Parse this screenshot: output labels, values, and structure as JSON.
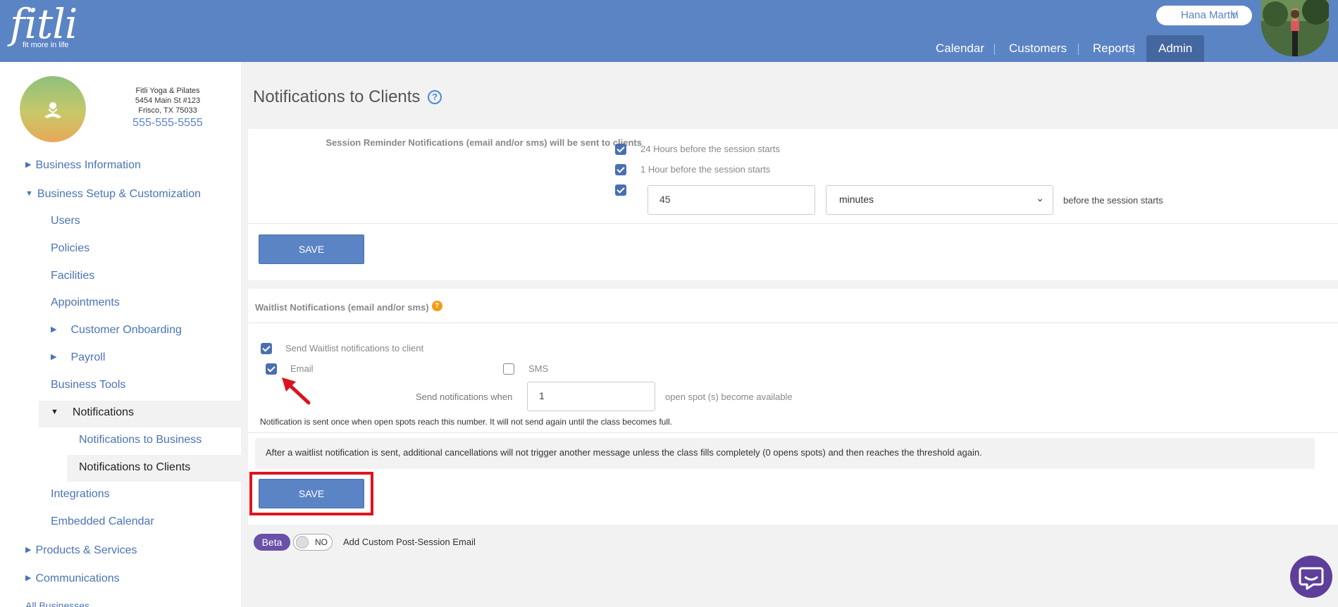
{
  "app": {
    "logo_text": "fitli",
    "logo_tagline": "fit more in life"
  },
  "header": {
    "user_name": "Hana Martin",
    "nav": [
      "Calendar",
      "Customers",
      "Reports",
      "Admin"
    ],
    "active_nav": "Admin"
  },
  "business": {
    "name": "Fitli Yoga & Pilates",
    "address1": "5454 Main St #123",
    "address2": "Frisco, TX 75033",
    "phone": "555-555-5555",
    "logo_text": "FITLI YOGA & PILATES"
  },
  "sidebar": {
    "items": [
      {
        "label": "Business Information",
        "caret": "▶"
      },
      {
        "label": "Business Setup & Customization",
        "caret": "▼"
      },
      {
        "label": "Users"
      },
      {
        "label": "Policies"
      },
      {
        "label": "Facilities"
      },
      {
        "label": "Appointments"
      },
      {
        "label": "Customer Onboarding",
        "caret": "▶"
      },
      {
        "label": "Payroll",
        "caret": "▶"
      },
      {
        "label": "Business Tools"
      },
      {
        "label": "Notifications",
        "caret": "▼"
      },
      {
        "label": "Notifications to Business"
      },
      {
        "label": "Notifications to Clients"
      },
      {
        "label": "Integrations"
      },
      {
        "label": "Embedded Calendar"
      },
      {
        "label": "Products & Services",
        "caret": "▶"
      },
      {
        "label": "Communications",
        "caret": "▶"
      },
      {
        "label": "All Businesses"
      }
    ]
  },
  "page": {
    "title": "Notifications to Clients",
    "help": "?"
  },
  "reminders": {
    "heading": "Session Reminder Notifications (email and/or sms) will be sent to clients",
    "option_24h": "24 Hours before the session starts",
    "option_1h": "1 Hour before the session starts",
    "custom_value": "45",
    "custom_unit": "minutes",
    "custom_suffix": "before the session starts",
    "save_label": "SAVE"
  },
  "waitlist": {
    "heading": "Waitlist Notifications (email and/or sms)",
    "help": "?",
    "send_label": "Send Waitlist notifications to client",
    "email_label": "Email",
    "sms_label": "SMS",
    "threshold_label": "Send notifications when",
    "threshold_value": "1",
    "threshold_suffix": "open spot (s) become available",
    "note": "Notification is sent once when open spots reach this number. It will not send again until the class becomes full.",
    "info": "After a waitlist notification is sent, additional cancellations will not trigger another message unless the class fills completely (0 opens spots) and then reaches the threshold again.",
    "save_label": "SAVE"
  },
  "footer": {
    "beta_label": "Beta",
    "toggle_label": "NO",
    "custom_email_label": "Add Custom Post-Session Email"
  },
  "colors": {
    "header": "#5b84c4",
    "accent": "#4a6fb0",
    "link": "#4a74b5",
    "highlight": "#e0141e",
    "beta": "#6b4fa8",
    "chat": "#5d3f9a"
  }
}
